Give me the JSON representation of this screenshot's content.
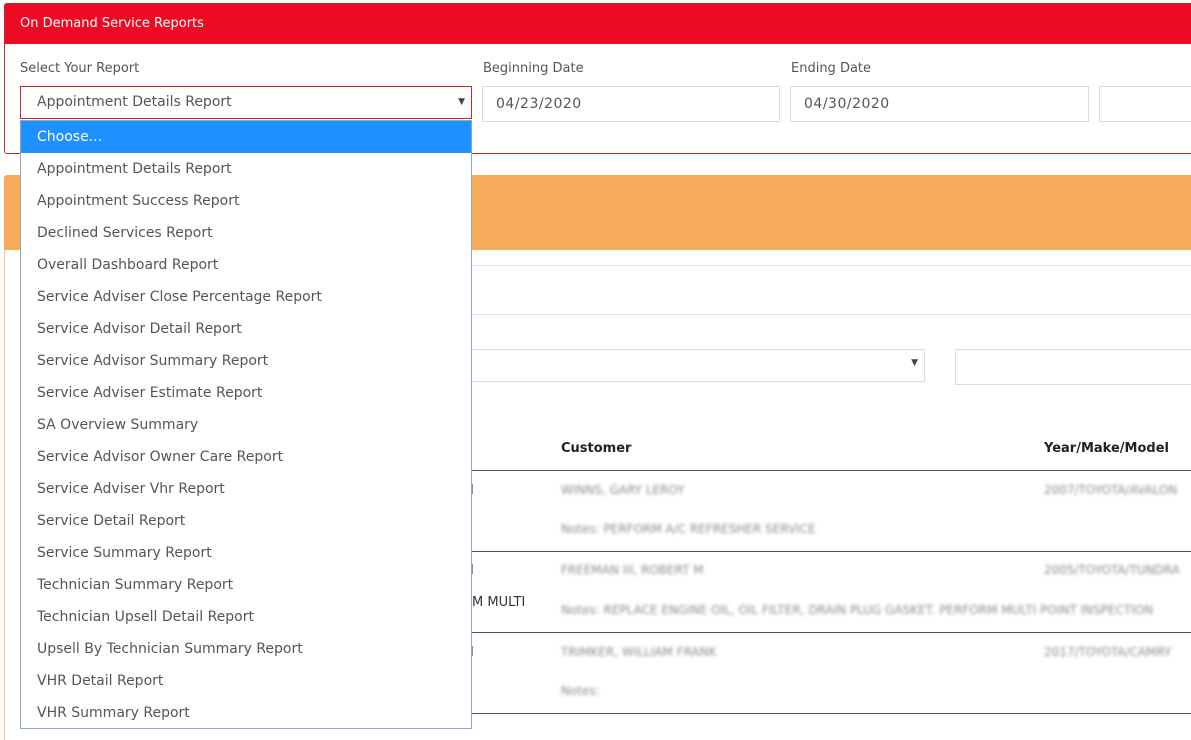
{
  "panel": {
    "title": "On Demand Service Reports",
    "report_label": "Select Your Report",
    "report_value": "Appointment Details Report",
    "begin_label": "Beginning Date",
    "begin_value": "04/23/2020",
    "end_label": "Ending Date",
    "end_value": "04/30/2020",
    "caret": "▼"
  },
  "dropdown": {
    "options": [
      "Choose...",
      "Appointment Details Report",
      "Appointment Success Report",
      "Declined Services Report",
      "Overall Dashboard Report",
      "Service Adviser Close Percentage Report",
      "Service Advisor Detail Report",
      "Service Advisor Summary Report",
      "Service Adviser Estimate Report",
      "SA Overview Summary",
      "Service Advisor Owner Care Report",
      "Service Adviser Vhr Report",
      "Service Detail Report",
      "Service Summary Report",
      "Technician Summary Report",
      "Technician Upsell Detail Report",
      "Upsell By Technician Summary Report",
      "VHR Detail Report",
      "VHR Summary Report"
    ],
    "highlighted_index": 0
  },
  "table": {
    "headers": {
      "customer": "Customer",
      "ymm": "Year/Make/Model"
    },
    "rows": [
      {
        "lead": "I",
        "customer": "WINNS, GARY LEROY",
        "ymm": "2007/TOYOTA/AVALON",
        "notes": "Notes: PERFORM A/C REFRESHER SERVICE",
        "extra": ""
      },
      {
        "lead": "I",
        "customer": "FREEMAN III, ROBERT M",
        "ymm": "2005/TOYOTA/TUNDRA",
        "notes": "Notes: REPLACE ENGINE OIL, OIL FILTER, DRAIN PLUG GASKET. PERFORM MULTI POINT INSPECTION",
        "extra": "M MULTI"
      },
      {
        "lead": "I",
        "customer": "TRIMKER, WILLIAM FRANK",
        "ymm": "2017/TOYOTA/CAMRY",
        "notes": "Notes:",
        "extra": ""
      }
    ]
  },
  "filter": {
    "caret": "▼"
  },
  "colors": {
    "header_red": "#ec0b22",
    "band_orange": "#f6ab5b",
    "highlight_blue": "#1e90ff"
  }
}
